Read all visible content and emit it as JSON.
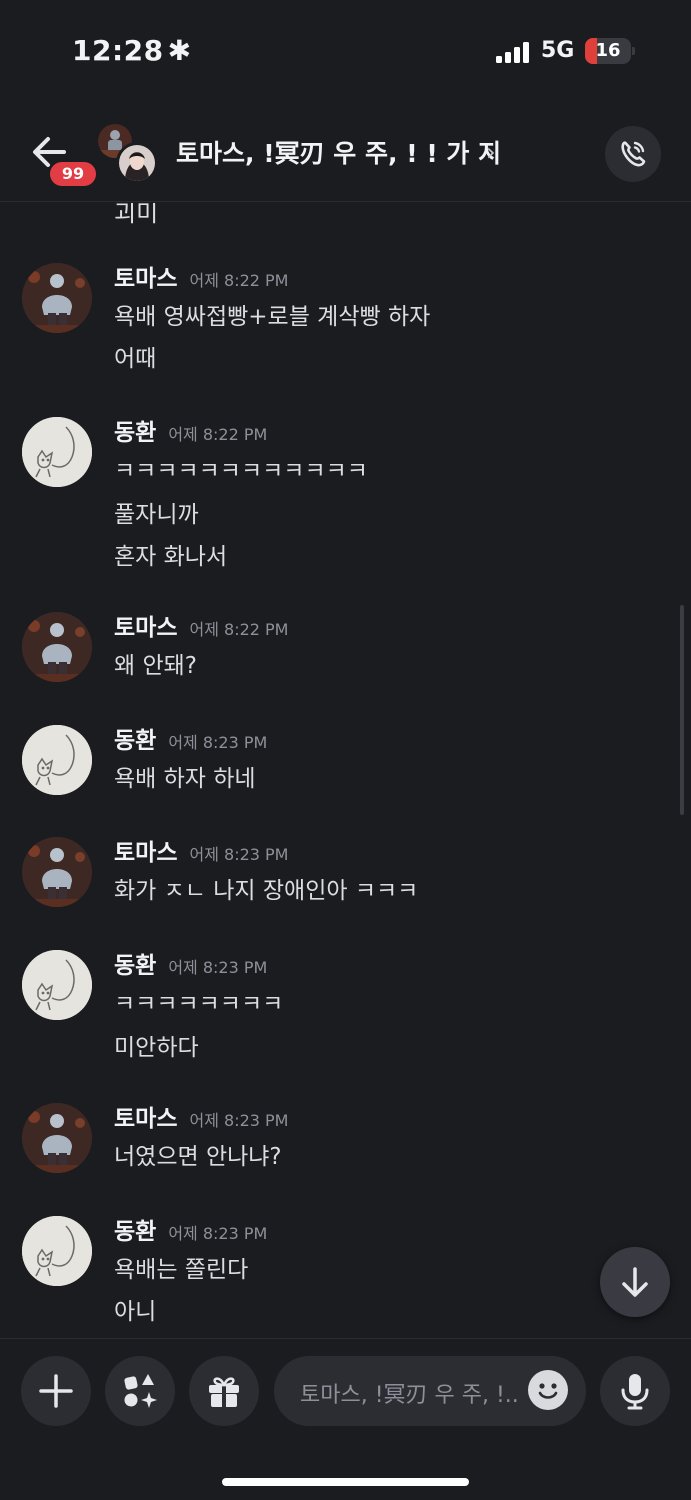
{
  "status": {
    "time": "12:28",
    "network": "5G",
    "battery": "16"
  },
  "header": {
    "unread_badge": "99",
    "title": "토마스, !冥刃 우 주, ! ! 가 지",
    "chevron": "›"
  },
  "partial_text": "괴미",
  "messages": [
    {
      "author": "토마스",
      "time": "어제 8:22 PM",
      "lines": [
        "욕배 영싸접빵+로블 계삭빵 하자",
        "어때"
      ]
    },
    {
      "author": "동환",
      "time": "어제 8:22 PM",
      "lines": [
        "ㅋㅋㅋㅋㅋㅋㅋㅋㅋㅋㅋㅋ",
        "풀자니까",
        "혼자 화나서"
      ]
    },
    {
      "author": "토마스",
      "time": "어제 8:22 PM",
      "lines": [
        "왜 안돼?"
      ]
    },
    {
      "author": "동환",
      "time": "어제 8:23 PM",
      "lines": [
        "욕배 하자 하네"
      ]
    },
    {
      "author": "토마스",
      "time": "어제 8:23 PM",
      "lines": [
        "화가 ㅈㄴ 나지 장애인아 ㅋㅋㅋ"
      ]
    },
    {
      "author": "동환",
      "time": "어제 8:23 PM",
      "lines": [
        "ㅋㅋㅋㅋㅋㅋㅋㅋ",
        "미안하다"
      ]
    },
    {
      "author": "토마스",
      "time": "어제 8:23 PM",
      "lines": [
        "너였으면 안나냐?"
      ]
    },
    {
      "author": "동환",
      "time": "어제 8:23 PM",
      "lines": [
        "욕배는 쫄린다",
        "아니"
      ]
    }
  ],
  "composer": {
    "placeholder": "토마스, !冥刃 우 주, !.."
  },
  "icons": {
    "back": "arrow-left-icon",
    "call": "phone-call-icon",
    "scroll_down": "arrow-down-icon",
    "plus": "plus-icon",
    "apps": "apps-icon",
    "gift": "gift-icon",
    "emoji": "emoji-icon",
    "mic": "microphone-icon"
  },
  "colors": {
    "background": "#1b1c20",
    "badge": "#e23c45",
    "timestamp": "#8e9099"
  }
}
